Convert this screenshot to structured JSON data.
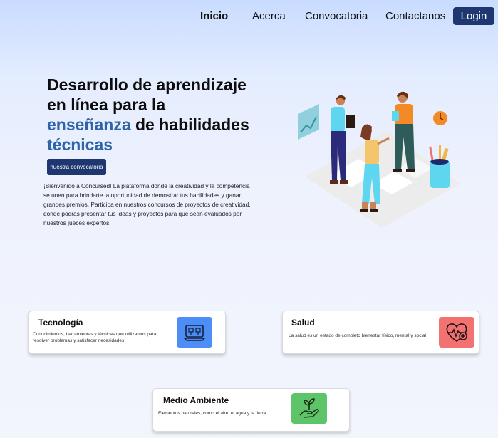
{
  "nav": {
    "items": [
      {
        "label": "Inicio",
        "active": true
      },
      {
        "label": "Acerca",
        "active": false
      },
      {
        "label": "Convocatoria",
        "active": false
      },
      {
        "label": "Contactanos",
        "active": false
      }
    ],
    "login_label": "Login"
  },
  "hero": {
    "title_part1": "Desarrollo de aprendizaje en línea para la ",
    "title_hl1": "enseñanza",
    "title_part2": " de habilidades ",
    "title_hl2": "técnicas",
    "cta_label": "nuestra convocatoria",
    "description": "¡Bienvenido a Concursed! La plataforma donde la creatividad y la competencia se unen para brindarte la oportunidad de demostrar tus habilidades y ganar grandes premios. Participa en nuestros concursos de proyectos de creatividad, donde podrás presentar tus ideas y proyectos para que sean evaluados por nuestros jueces expertos."
  },
  "categories": [
    {
      "title": "Tecnología",
      "description": "Conocimientos, herramientas y técnicas que utilizamos para resolver problemas y satisfacer necesidades",
      "icon": "technology-icon",
      "color": "#4c8ef5"
    },
    {
      "title": "Salud",
      "description": "La salud es un estado de completo bienestar físico, mental y social",
      "icon": "health-heart-icon",
      "color": "#f27272"
    },
    {
      "title": "Medio Ambiente",
      "description": "Elementos naturales, como el aire, el agua y la tierra",
      "icon": "plant-hand-icon",
      "color": "#5ec46a"
    }
  ],
  "colors": {
    "primary": "#1e3770",
    "accent": "#2f64a8"
  }
}
